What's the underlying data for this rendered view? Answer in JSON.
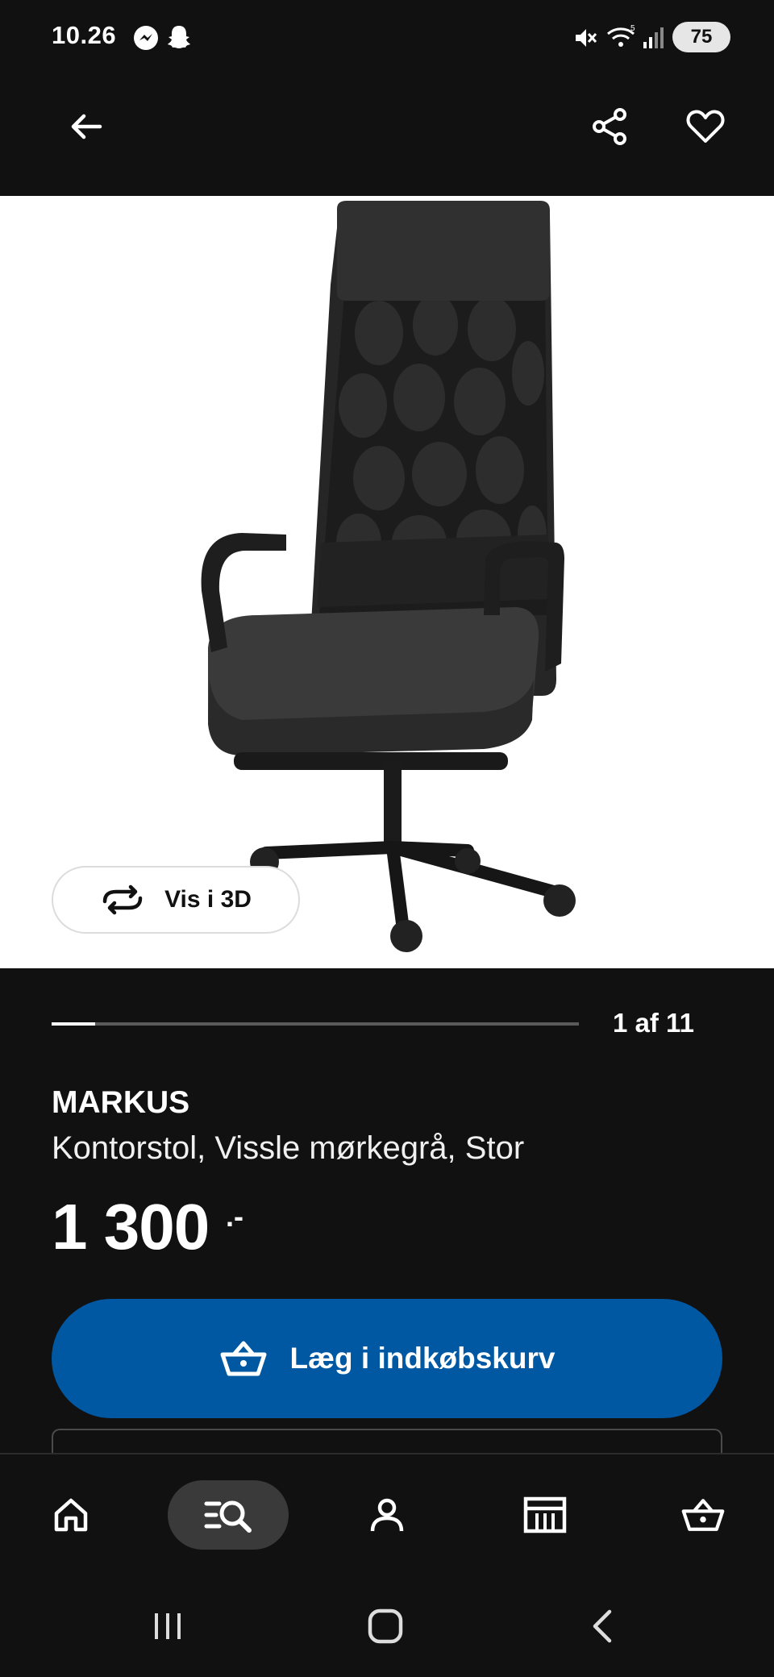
{
  "status_bar": {
    "time": "10.26",
    "battery": "75",
    "icons": [
      "messenger-icon",
      "snapchat-icon",
      "mute-icon",
      "wifi-icon",
      "signal-icon",
      "battery-icon"
    ]
  },
  "top_bar": {
    "icons": [
      "back-arrow-icon",
      "share-icon",
      "heart-icon"
    ]
  },
  "gallery": {
    "view_3d_label": "Vis i 3D",
    "counter": "1 af 11",
    "current": 1,
    "total": 11
  },
  "product": {
    "name": "MARKUS",
    "description": "Kontorstol, Vissle mørkegrå, Stor",
    "price": "1 300",
    "price_suffix": ".-"
  },
  "cta": {
    "add_to_cart_label": "Læg i indkøbskurv"
  },
  "bottom_nav": {
    "items": [
      "home-icon",
      "search-list-icon",
      "profile-icon",
      "store-icon",
      "basket-icon"
    ],
    "active": "search-list-icon"
  },
  "system_nav": {
    "items": [
      "recents-icon",
      "home-circle-icon",
      "back-icon"
    ]
  },
  "colors": {
    "background": "#111111",
    "accent_blue": "#0058a3",
    "image_background": "#ffffff"
  }
}
